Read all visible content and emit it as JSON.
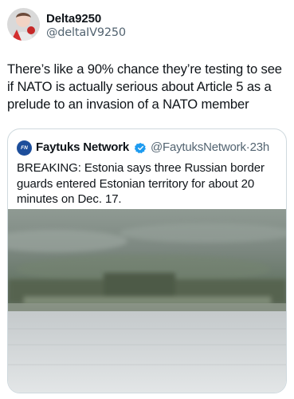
{
  "author": {
    "display_name": "Delta9250",
    "handle": "@deltaIV9250"
  },
  "tweet": {
    "text": "There’s like a 90% chance they’re testing to see if NATO is actually serious about Article 5 as a prelude to an invasion of a NATO member"
  },
  "quoted_tweet": {
    "display_name": "Faytuks Network",
    "logo_text": "FN",
    "handle": "@FaytuksNetwork",
    "separator": "·",
    "time": "23h",
    "text": "BREAKING: Estonia says three Russian border guards entered Estonian territory for about 20 minutes on Dec. 17."
  },
  "colors": {
    "verified_badge": "#1d9bf0",
    "secondary_text": "#536471",
    "border": "#cfd9de"
  }
}
